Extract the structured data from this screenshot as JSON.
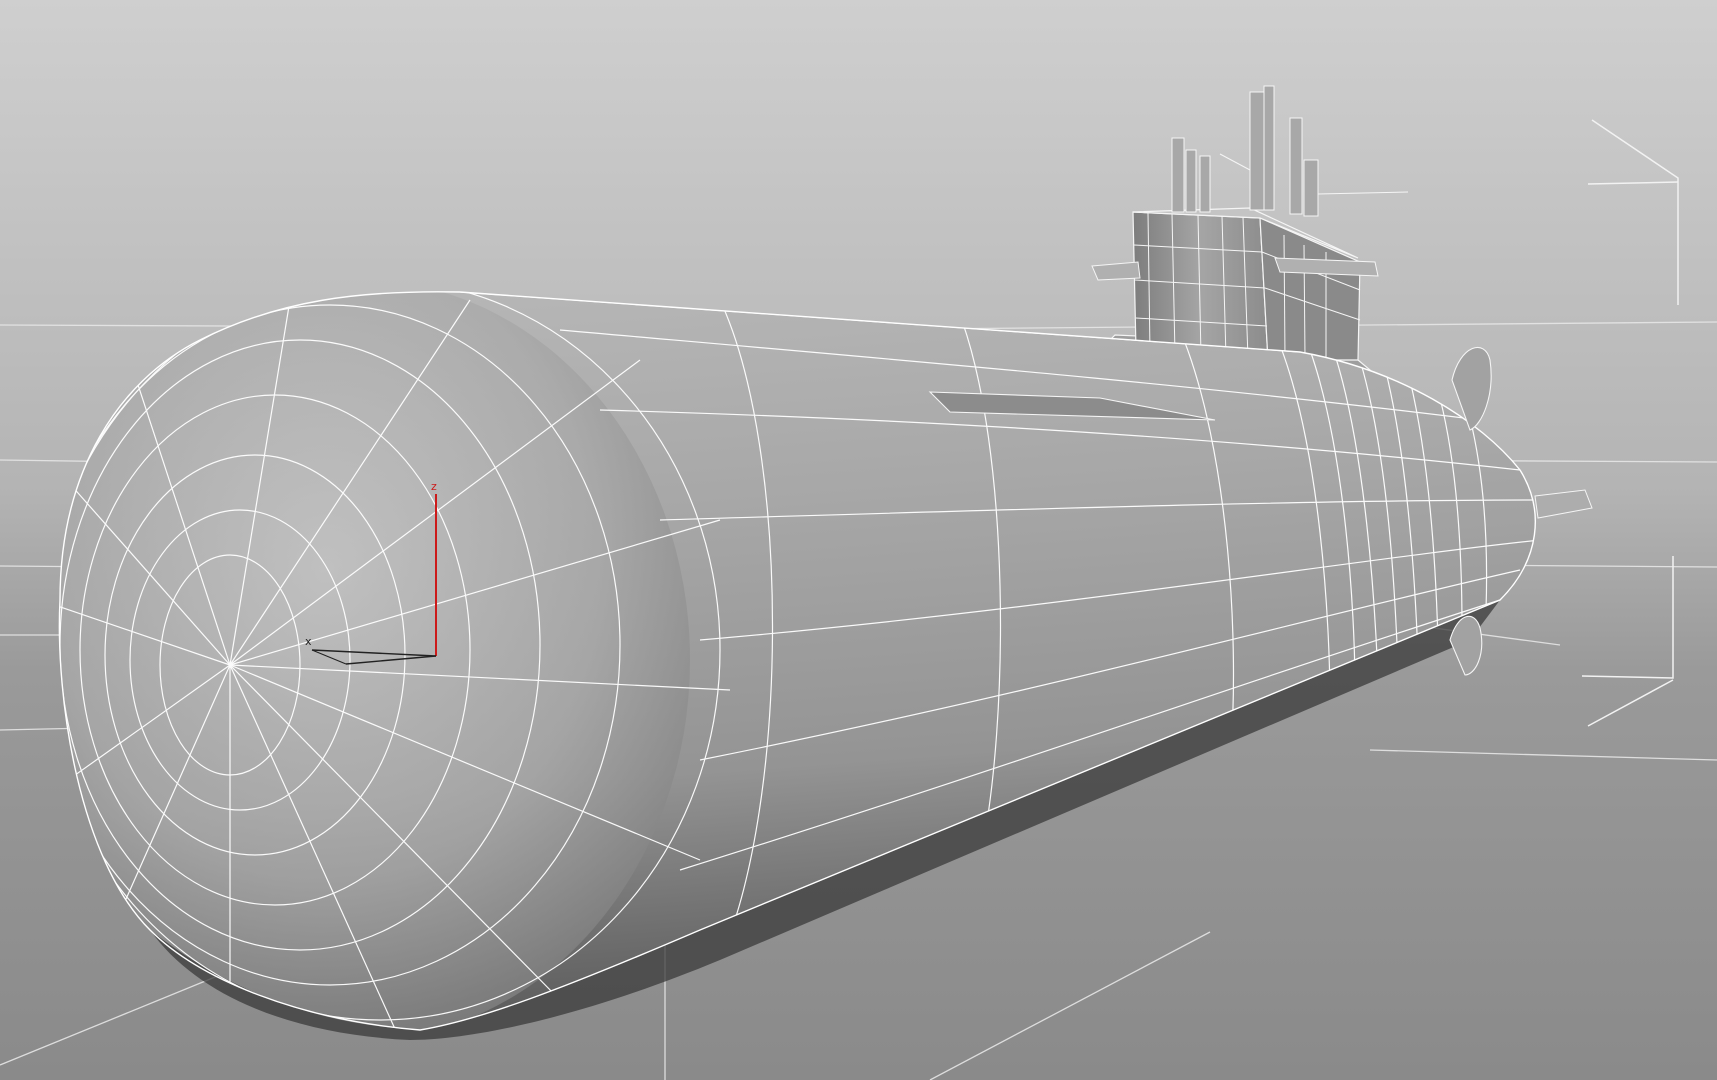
{
  "viewport": {
    "kind": "3D perspective viewport (wireframe over shaded)",
    "background_top": "#c6c6c6",
    "background_bottom": "#8e8e8e",
    "wire_color": "#ffffff",
    "object": "submarine-model"
  },
  "gizmo": {
    "axis_x_label": "x",
    "axis_z_label": "z",
    "axis_z_color": "#cc1a1a",
    "axis_x_color": "#222222"
  },
  "icons": {
    "bounding_brackets": "selection-bracket-icon",
    "gizmo": "transform-gizmo-icon"
  }
}
